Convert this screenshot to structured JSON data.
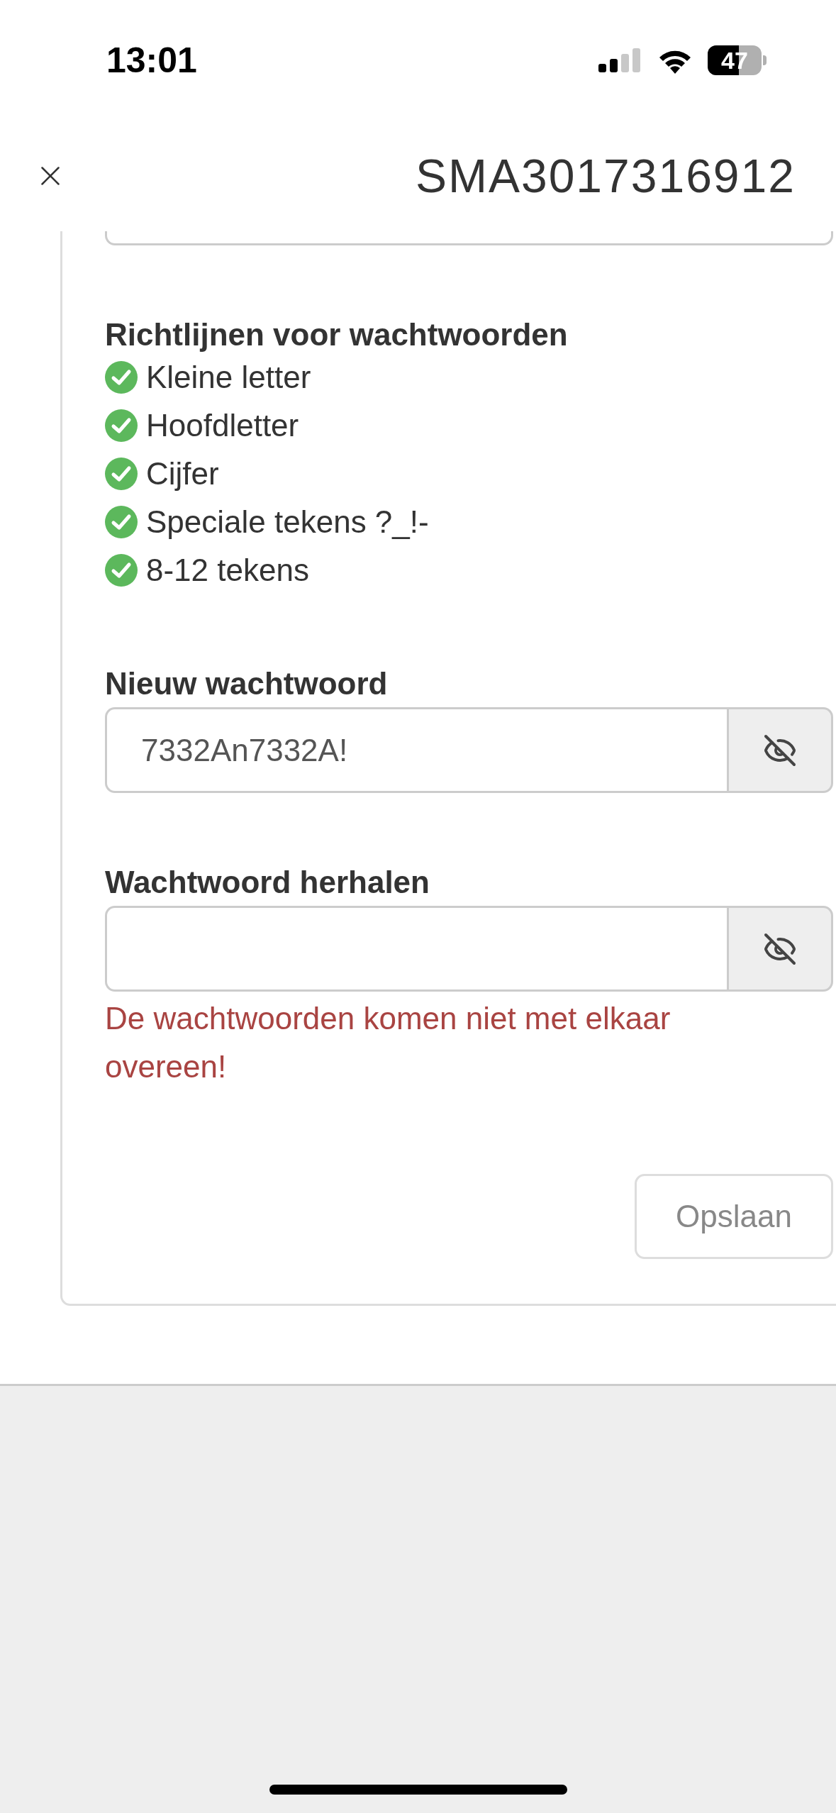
{
  "status_bar": {
    "time": "13:01",
    "battery": "47"
  },
  "header": {
    "title": "SMA3017316912"
  },
  "guidelines": {
    "title": "Richtlijnen voor wachtwoorden",
    "items": [
      {
        "label": "Kleine letter",
        "checked": true
      },
      {
        "label": "Hoofdletter",
        "checked": true
      },
      {
        "label": "Cijfer",
        "checked": true
      },
      {
        "label": "Speciale tekens ?_!-",
        "checked": true
      },
      {
        "label": "8-12 tekens",
        "checked": true
      }
    ]
  },
  "fields": [
    {
      "label": "Nieuw wachtwoord",
      "value": "7332An7332A!"
    },
    {
      "label": "Wachtwoord herhalen",
      "error": "De wachtwoorden komen niet met elkaar overeen!"
    }
  ],
  "save_button": {
    "label": "Opslaan",
    "disabled": true
  }
}
